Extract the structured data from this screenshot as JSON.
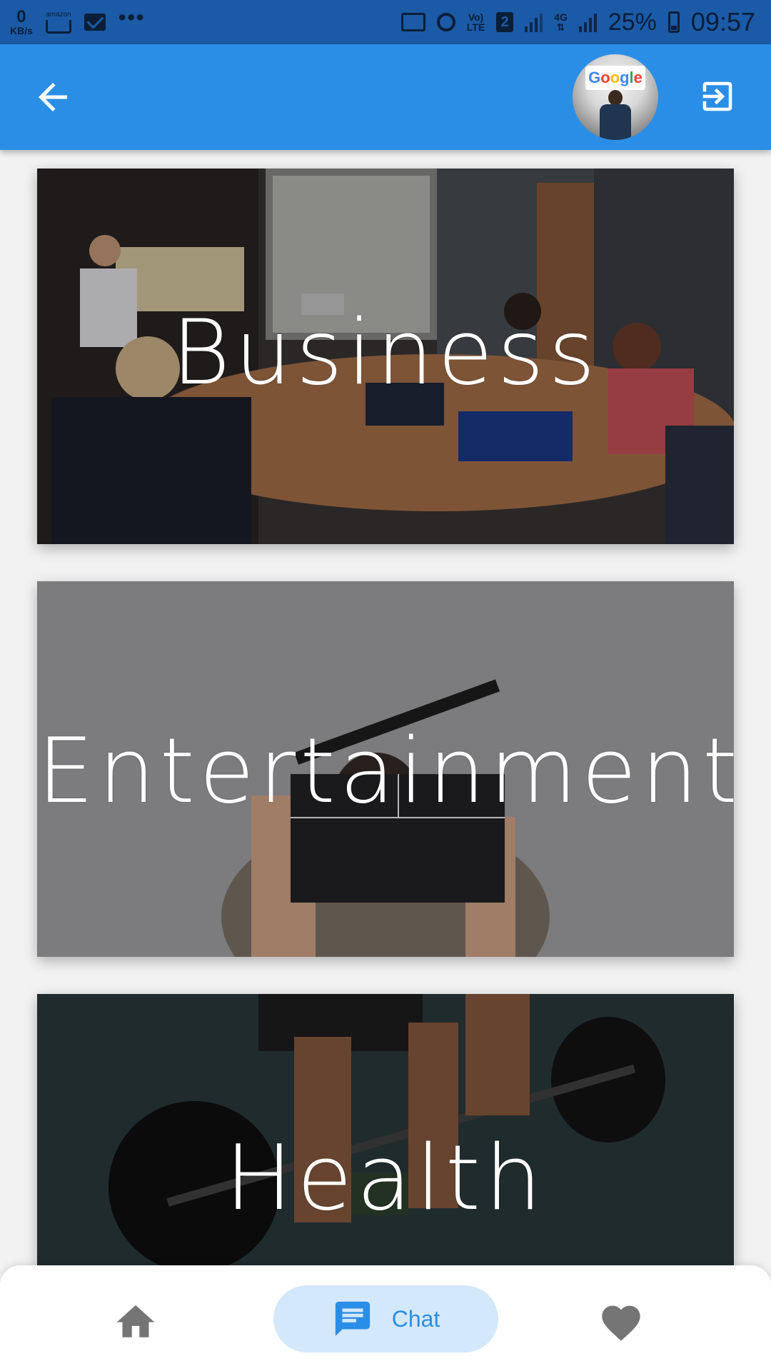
{
  "status_bar": {
    "speed_value": "0",
    "speed_unit": "KB/s",
    "amazon_label": "amazon",
    "more_label": "•••",
    "volte_top": "Vo)",
    "volte_bottom": "LTE",
    "sim_number": "2",
    "net_type": "4G",
    "battery_percent": "25%",
    "time": "09:57"
  },
  "app_bar": {
    "back_icon": "arrow-left-icon",
    "avatar_sign_text": "Google",
    "logout_icon": "logout-icon",
    "background_color": "#2b8ee6"
  },
  "categories": [
    {
      "label": "Business",
      "image": "meeting-room-photo"
    },
    {
      "label": "Entertainment",
      "image": "clapperboard-photo"
    },
    {
      "label": "Health",
      "image": "barbell-photo"
    }
  ],
  "bottom_nav": {
    "items": [
      {
        "icon": "home-icon",
        "label": ""
      },
      {
        "icon": "chat-icon",
        "label": "Chat",
        "active": true
      },
      {
        "icon": "heart-icon",
        "label": ""
      }
    ],
    "active_color": "#2b8ee6",
    "inactive_color": "#757575"
  }
}
